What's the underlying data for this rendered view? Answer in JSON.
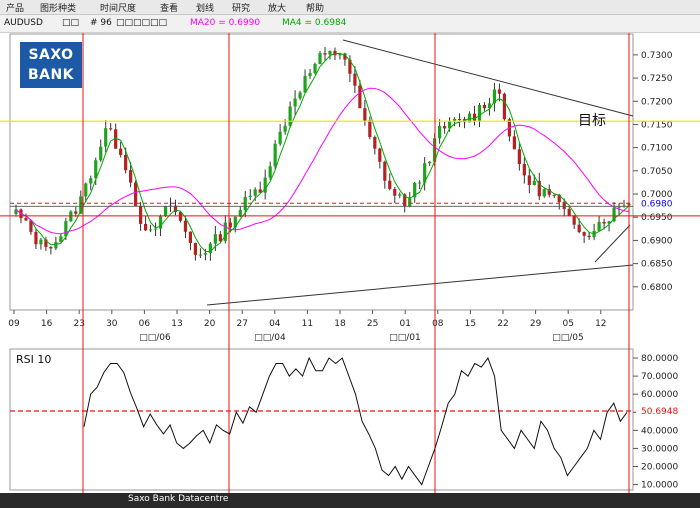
{
  "menu": [
    "产品",
    "图形种类",
    "时间尺度",
    "查看",
    "划线",
    "研究",
    "放大",
    "帮助"
  ],
  "info": {
    "symbol": "AUDUSD",
    "blank1": "□□",
    "period": "# 96",
    "blank2": "□□□□□□",
    "ma20": "MA20 = 0.6990",
    "ma4": "MA4 = 0.6984"
  },
  "logo": {
    "line1": "SAXO",
    "line2": "BANK"
  },
  "colors": {
    "ma20": "#ff00ff",
    "ma4": "#00aa00",
    "up": "#1fa31f",
    "down": "#b52020",
    "target": "#e6e600",
    "crosshair": "#ee1111"
  },
  "annotation": "目标",
  "price_label": "0.6980",
  "rsi_label": "50.6948",
  "status": "Saxo Bank Datacentre",
  "chart_data": [
    {
      "type": "candlestick",
      "series": [
        {
          "name": "MA20"
        },
        {
          "name": "MA4"
        }
      ],
      "x_ticks": [
        "09",
        "16",
        "23",
        "30",
        "06",
        "13",
        "20",
        "27",
        "04",
        "11",
        "18",
        "25",
        "01",
        "08",
        "15",
        "22",
        "29",
        "05",
        "12"
      ],
      "months": [
        "□□/06",
        "□□/04",
        "□□/01",
        "□□/05"
      ],
      "ylim": [
        0.675,
        0.7345
      ],
      "y_ticks": [
        "0.7300",
        "0.7250",
        "0.7200",
        "0.7150",
        "0.7100",
        "0.7050",
        "0.7000",
        "0.6950",
        "0.6900",
        "0.6850",
        "0.6800"
      ],
      "target": 0.7157,
      "close_level": 0.698,
      "h_line": 0.6953
    },
    {
      "type": "line",
      "title": "RSI 10",
      "ylim": [
        7,
        85
      ],
      "y_ticks": [
        "80.0000",
        "70.0000",
        "60.0000",
        "50.0000",
        "40.0000",
        "30.0000",
        "20.0000",
        "10.0000"
      ],
      "current": 50.6948,
      "values": [
        42,
        60,
        64,
        72,
        77,
        77,
        72,
        61,
        52,
        42,
        49,
        43,
        38,
        43,
        33,
        30,
        33,
        37,
        40,
        33,
        43,
        40,
        38,
        50,
        44,
        53,
        50,
        60,
        70,
        77,
        77,
        70,
        74,
        70,
        80,
        73,
        73,
        80,
        77,
        80,
        70,
        60,
        45,
        38,
        30,
        18,
        15,
        20,
        13,
        20,
        15,
        10,
        20,
        30,
        42,
        55,
        60,
        73,
        70,
        77,
        75,
        80,
        70,
        40,
        35,
        30,
        40,
        35,
        30,
        45,
        40,
        30,
        25,
        15,
        20,
        25,
        30,
        40,
        35,
        50,
        55,
        45,
        50
      ]
    }
  ]
}
